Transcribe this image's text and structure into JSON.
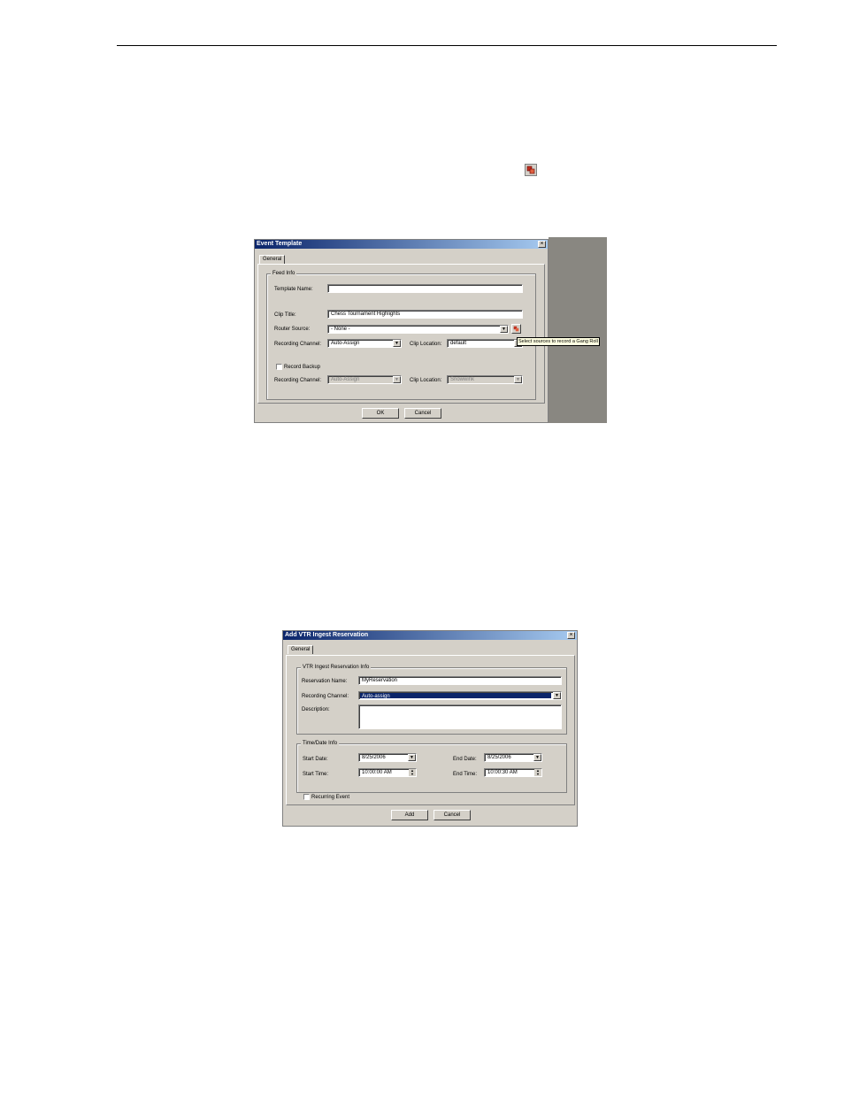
{
  "event_template": {
    "title": "Event Template",
    "close_glyph": "×",
    "tab": "General",
    "group": "Feed Info",
    "template_name_label": "Template Name:",
    "template_name_value": "",
    "clip_title_label": "Clip Title:",
    "clip_title_value": "Chess Tournament Highlights",
    "router_source_label": "Router Source:",
    "router_source_value": "- None -",
    "recording_channel_label": "Recording Channel:",
    "recording_channel_value": "Auto-Assign",
    "clip_location_label": "Clip Location:",
    "clip_location_value": "default",
    "record_backup_label": "Record Backup",
    "backup_recording_channel_label": "Recording Channel:",
    "backup_recording_channel_value": "Auto-Assign",
    "backup_clip_location_label": "Clip Location:",
    "backup_clip_location_value": "Snowwink",
    "tooltip": "Select sources to record a Gang Roll",
    "ok_label": "OK",
    "cancel_label": "Cancel"
  },
  "vtr_dialog": {
    "title": "Add VTR Ingest Reservation",
    "close_glyph": "×",
    "tab": "General",
    "group1": "VTR Ingest Reservation Info",
    "reservation_name_label": "Reservation Name:",
    "reservation_name_value": "MyReservation",
    "recording_channel_label": "Recording Channel:",
    "recording_channel_value": "Auto-assign",
    "description_label": "Description:",
    "description_value": "",
    "group2": "Time/Date Info",
    "start_date_label": "Start Date:",
    "start_date_value": "8/25/2006",
    "end_date_label": "End Date:",
    "end_date_value": "8/25/2006",
    "start_time_label": "Start Time:",
    "start_time_value": "10:00:00 AM",
    "end_time_label": "End Time:",
    "end_time_value": "10:00:30 AM",
    "recurring_label": "Recurring Event",
    "add_label": "Add",
    "cancel_label": "Cancel"
  },
  "icons": {
    "dropdown": "▼",
    "spin_up": "▲",
    "spin_down": "▼"
  }
}
